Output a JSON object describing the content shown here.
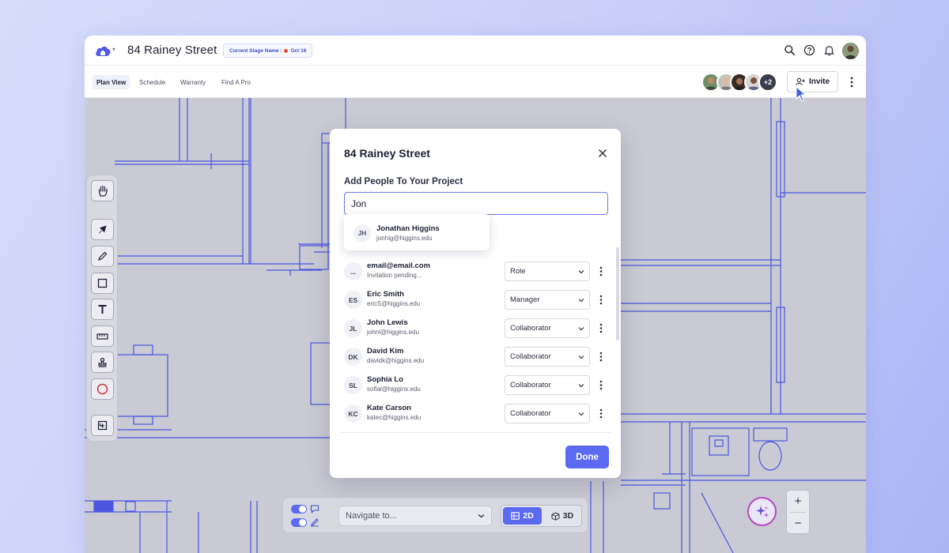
{
  "header": {
    "project_title": "84 Rainey Street",
    "stage_label": "Current Stage Name :",
    "stage_date": "Oct 16",
    "icons": [
      "home-cloud-logo-icon",
      "search-icon",
      "help-icon",
      "bell-icon"
    ]
  },
  "nav": {
    "tabs": [
      {
        "label": "Plan View",
        "active": true
      },
      {
        "label": "Schedule",
        "active": false
      },
      {
        "label": "Warranty",
        "active": false
      },
      {
        "label": "Find A Pro",
        "active": false
      }
    ],
    "more_count": "+2",
    "invite_label": "Invite"
  },
  "toolbar": {
    "tools": [
      "hand-icon",
      "select-arrow-icon",
      "pencil-icon",
      "rectangle-icon",
      "text-icon",
      "ruler-icon",
      "stamp-icon",
      "circle-icon",
      "add-frame-icon"
    ]
  },
  "modal": {
    "title": "84 Rainey Street",
    "add_label": "Add People To Your Project",
    "search_value": "Jon",
    "suggestion": {
      "initials": "JH",
      "name": "Jonathan Higgins",
      "email": "jonhig@higgins.edu"
    },
    "people": [
      {
        "initials": "...",
        "name": "email@email.com",
        "sub": "Invitation pending...",
        "role": "Role"
      },
      {
        "initials": "ES",
        "name": "Eric Smith",
        "sub": "ericS@higgins.edu",
        "role": "Manager"
      },
      {
        "initials": "JL",
        "name": "John Lewis",
        "sub": "johnl@higgins.edu",
        "role": "Collaborator"
      },
      {
        "initials": "DK",
        "name": "David Kim",
        "sub": "davidk@higgins.edu",
        "role": "Collaborator"
      },
      {
        "initials": "SL",
        "name": "Sophia Lo",
        "sub": "sofial@higgins.edu",
        "role": "Collaborator"
      },
      {
        "initials": "KC",
        "name": "Kate Carson",
        "sub": "katec@higgins.edu",
        "role": "Collaborator"
      }
    ],
    "done_label": "Done"
  },
  "bottom_bar": {
    "navigate_placeholder": "Navigate to...",
    "mode_2d": "2D",
    "mode_3d": "3D",
    "active_mode": "2D"
  },
  "zoom": {
    "in": "+",
    "out": "−"
  },
  "colors": {
    "accent": "#5b6af0",
    "blueprint_line": "#4a55e0",
    "canvas_bg": "#c9cad3",
    "stage_text": "#3f4fc9",
    "ai_ring": "#b249c4"
  }
}
